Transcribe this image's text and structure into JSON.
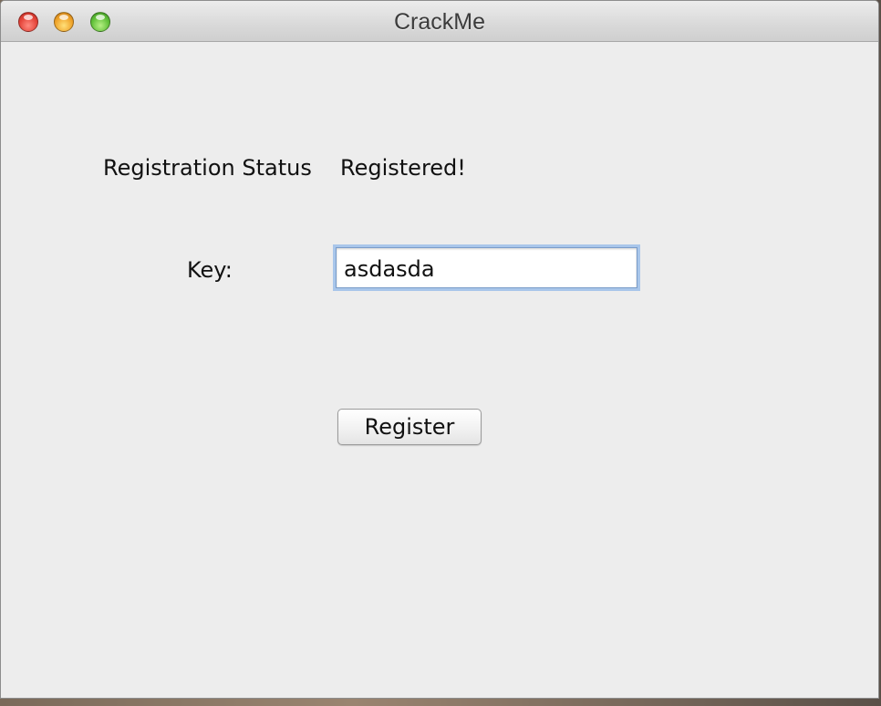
{
  "window": {
    "title": "CrackMe"
  },
  "registration": {
    "status_label": "Registration Status",
    "status_value": "Registered!"
  },
  "key": {
    "label": "Key:",
    "value": "asdasda"
  },
  "actions": {
    "register_label": "Register"
  },
  "colors": {
    "window_background": "#ededed",
    "focus_ring": "#a9c6ea",
    "close": "#e5453a",
    "minimize": "#f0a42a",
    "maximize": "#62c13a"
  },
  "icons": {
    "close": "close-icon",
    "minimize": "minimize-icon",
    "maximize": "maximize-icon"
  }
}
